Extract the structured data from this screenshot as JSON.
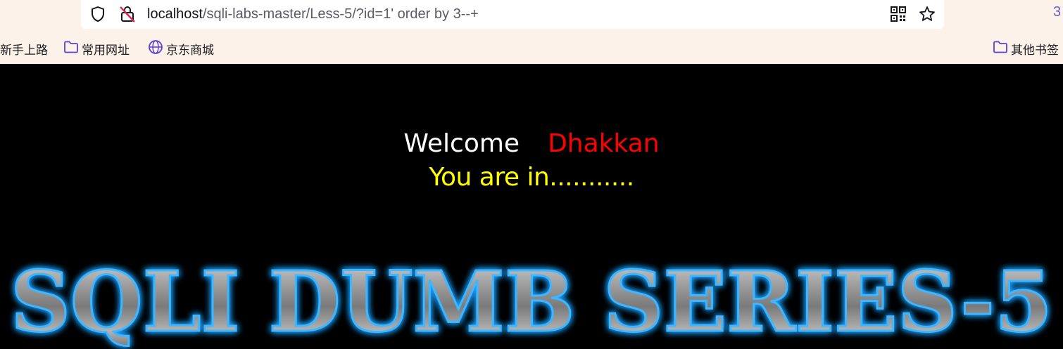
{
  "browser": {
    "url_host": "localhost",
    "url_path": "/sqli-labs-master/Less-5/?id=1' order by 3--+",
    "icons": {
      "tracking": "shield-icon",
      "security": "insecure-lock-icon",
      "qr": "qr-code-icon",
      "bookmark": "star-icon"
    },
    "extension_badge": "3"
  },
  "bookmarks": {
    "items": [
      {
        "label": "新手上路",
        "icon": "none"
      },
      {
        "label": "常用网址",
        "icon": "folder-icon"
      },
      {
        "label": "京东商城",
        "icon": "globe-icon"
      }
    ],
    "other": {
      "label": "其他书签",
      "icon": "folder-icon"
    }
  },
  "page": {
    "welcome_word": "Welcome",
    "user_name": "Dhakkan",
    "status_message": "You are in...........",
    "banner_text": "SQLI DUMB SERIES-5",
    "colors": {
      "background": "#000000",
      "welcome": "#ffffff",
      "user_name": "#ff0000",
      "status": "#ffff00",
      "banner_glow": "#1ea0ff"
    }
  }
}
